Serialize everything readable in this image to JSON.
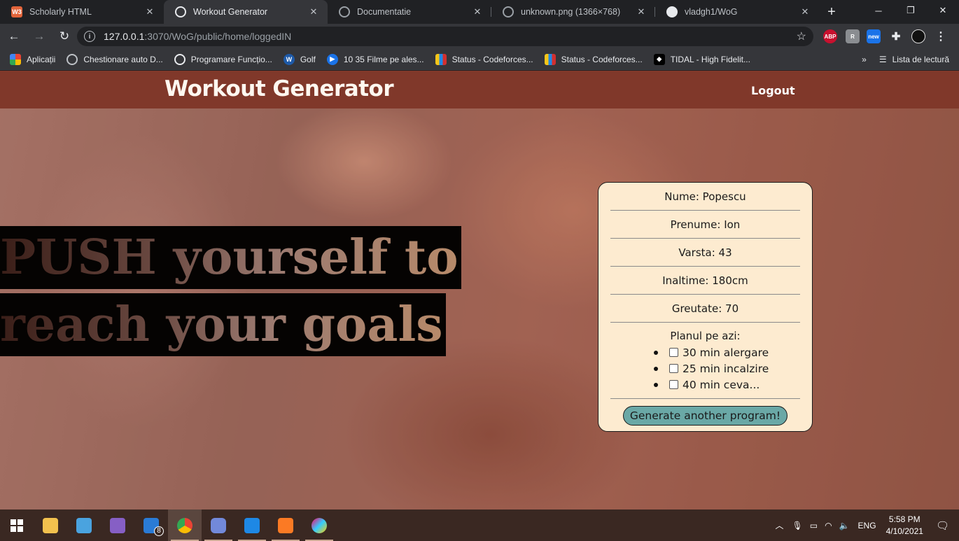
{
  "browser": {
    "tabs": [
      {
        "title": "Scholarly HTML",
        "favicon": "w3-icon",
        "active": false
      },
      {
        "title": "Workout Generator",
        "favicon": "globe-icon",
        "active": true
      },
      {
        "title": "Documentatie",
        "favicon": "globe-icon",
        "active": false
      },
      {
        "title": "unknown.png (1366×768)",
        "favicon": "globe-icon",
        "active": false
      },
      {
        "title": "vladgh1/WoG",
        "favicon": "github-icon",
        "active": false
      }
    ],
    "address": {
      "host": "127.0.0.1",
      "path": ":3070/WoG/public/home/loggedIN"
    },
    "extensions": [
      "ABP",
      "new"
    ],
    "bookmarks": [
      {
        "label": "Aplicații",
        "icon": "apps-grid-icon"
      },
      {
        "label": "Chestionare auto D...",
        "icon": "steering-wheel-icon"
      },
      {
        "label": "Programare Funcțio...",
        "icon": "globe-icon"
      },
      {
        "label": "Golf",
        "icon": "vw-logo-icon"
      },
      {
        "label": "10 35 Filme pe ales...",
        "icon": "play-icon"
      },
      {
        "label": "Status - Codeforces...",
        "icon": "codeforces-icon"
      },
      {
        "label": "Status - Codeforces...",
        "icon": "codeforces-icon"
      },
      {
        "label": "TIDAL - High Fidelit...",
        "icon": "tidal-icon"
      }
    ],
    "reading_list": "Lista de lectură"
  },
  "site": {
    "brand": "Workout Generator",
    "logout": "Logout",
    "slogan_line1": "PUSH yourself to",
    "slogan_line2": "reach your goals"
  },
  "profile": {
    "nume": "Nume: Popescu",
    "prenume": "Prenume: Ion",
    "varsta": "Varsta: 43",
    "inaltime": "Inaltime: 180cm",
    "greutate": "Greutate: 70"
  },
  "plan": {
    "heading": "Planul pe azi:",
    "items": [
      "30 min alergare",
      "25 min incalzire",
      "40 min ceva..."
    ],
    "generate_button": "Generate another program!"
  },
  "taskbar": {
    "badge_count": "8",
    "language": "ENG",
    "time": "5:58 PM",
    "date": "4/10/2021"
  },
  "colors": {
    "navbar": "#80382a",
    "card_bg": "#fdebd0",
    "button_bg": "#6aa8a6"
  }
}
